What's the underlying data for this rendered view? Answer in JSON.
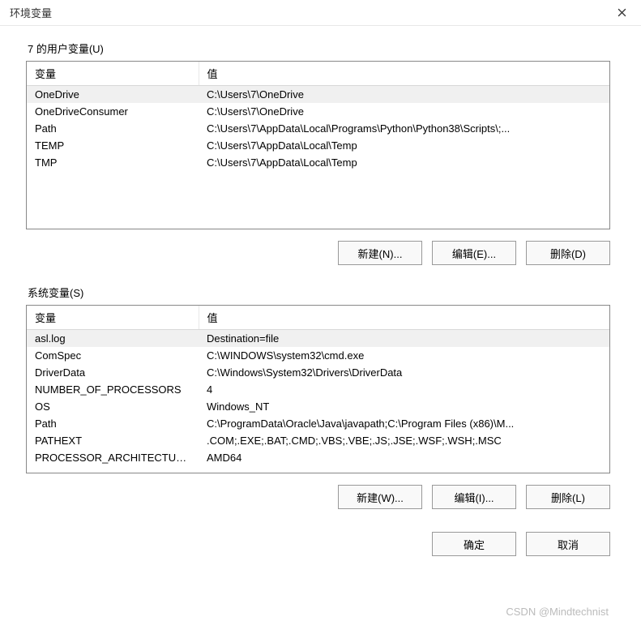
{
  "title": "环境变量",
  "user_section": {
    "label": "7 的用户变量(U)",
    "columns": {
      "var": "变量",
      "val": "值"
    },
    "rows": [
      {
        "var": "OneDrive",
        "val": "C:\\Users\\7\\OneDrive"
      },
      {
        "var": "OneDriveConsumer",
        "val": "C:\\Users\\7\\OneDrive"
      },
      {
        "var": "Path",
        "val": "C:\\Users\\7\\AppData\\Local\\Programs\\Python\\Python38\\Scripts\\;..."
      },
      {
        "var": "TEMP",
        "val": "C:\\Users\\7\\AppData\\Local\\Temp"
      },
      {
        "var": "TMP",
        "val": "C:\\Users\\7\\AppData\\Local\\Temp"
      }
    ],
    "buttons": {
      "new": "新建(N)...",
      "edit": "编辑(E)...",
      "delete": "删除(D)"
    }
  },
  "system_section": {
    "label": "系统变量(S)",
    "columns": {
      "var": "变量",
      "val": "值"
    },
    "rows": [
      {
        "var": "asl.log",
        "val": "Destination=file"
      },
      {
        "var": "ComSpec",
        "val": "C:\\WINDOWS\\system32\\cmd.exe"
      },
      {
        "var": "DriverData",
        "val": "C:\\Windows\\System32\\Drivers\\DriverData"
      },
      {
        "var": "NUMBER_OF_PROCESSORS",
        "val": "4"
      },
      {
        "var": "OS",
        "val": "Windows_NT"
      },
      {
        "var": "Path",
        "val": "C:\\ProgramData\\Oracle\\Java\\javapath;C:\\Program Files (x86)\\M..."
      },
      {
        "var": "PATHEXT",
        "val": ".COM;.EXE;.BAT;.CMD;.VBS;.VBE;.JS;.JSE;.WSF;.WSH;.MSC"
      },
      {
        "var": "PROCESSOR_ARCHITECTURE",
        "val": "AMD64"
      }
    ],
    "buttons": {
      "new": "新建(W)...",
      "edit": "编辑(I)...",
      "delete": "删除(L)"
    }
  },
  "footer": {
    "ok": "确定",
    "cancel": "取消"
  },
  "watermark": "CSDN @Mindtechnist"
}
